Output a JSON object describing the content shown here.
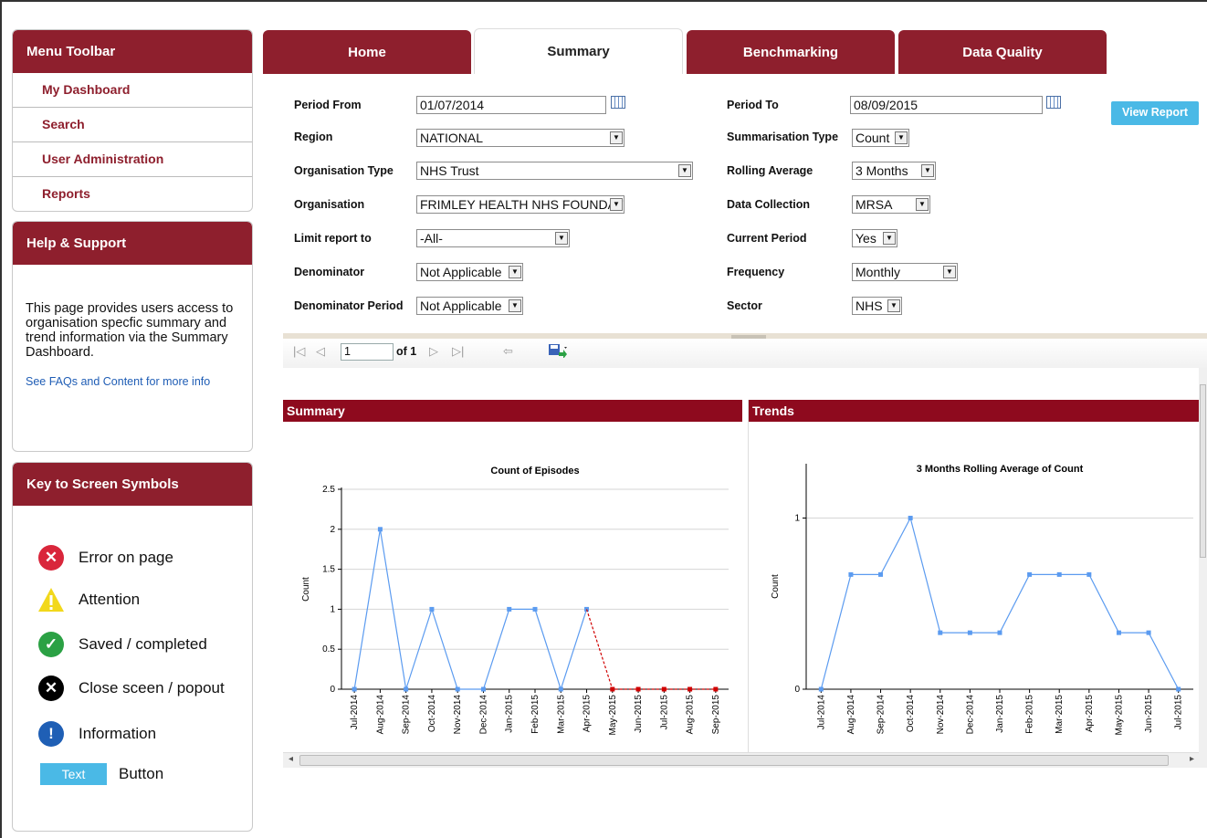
{
  "menu": {
    "title": "Menu Toolbar",
    "items": [
      "My Dashboard",
      "Search",
      "User Administration",
      "Reports"
    ]
  },
  "help": {
    "title": "Help & Support",
    "text": "This page provides users access to organisation specfic summary and trend information via the Summary Dashboard.",
    "link": "See FAQs and Content for more info"
  },
  "key": {
    "title": "Key to Screen Symbols",
    "items": [
      {
        "label": "Error on page",
        "icon": "error-icon",
        "color": "#d9263b",
        "glyph": "✕"
      },
      {
        "label": "Attention",
        "icon": "warning-icon",
        "color": "#f2d81b",
        "glyph": "!"
      },
      {
        "label": "Saved / completed",
        "icon": "check-icon",
        "color": "#2ba144",
        "glyph": "✓"
      },
      {
        "label": "Close sceen / popout",
        "icon": "close-icon",
        "color": "#000000",
        "glyph": "✕"
      },
      {
        "label": "Information",
        "icon": "info-icon",
        "color": "#1f5fb5",
        "glyph": "!"
      }
    ],
    "button_sample": "Text",
    "button_label": "Button"
  },
  "tabs": [
    "Home",
    "Summary",
    "Benchmarking",
    "Data Quality"
  ],
  "form": {
    "left": [
      {
        "label": "Period From",
        "value": "01/07/2014",
        "kind": "date"
      },
      {
        "label": "Region",
        "value": "NATIONAL",
        "kind": "select"
      },
      {
        "label": "Organisation Type",
        "value": "NHS Trust",
        "kind": "select"
      },
      {
        "label": "Organisation",
        "value": "FRIMLEY HEALTH NHS FOUNDATION TRUST",
        "kind": "select"
      },
      {
        "label": "Limit report to",
        "value": "-All-",
        "kind": "select"
      },
      {
        "label": "Denominator",
        "value": "Not Applicable",
        "kind": "select"
      },
      {
        "label": "Denominator Period",
        "value": "Not Applicable",
        "kind": "select"
      }
    ],
    "right": [
      {
        "label": "Period To",
        "value": "08/09/2015",
        "kind": "date"
      },
      {
        "label": "Summarisation Type",
        "value": "Count",
        "kind": "select"
      },
      {
        "label": "Rolling Average",
        "value": "3 Months",
        "kind": "select"
      },
      {
        "label": "Data Collection",
        "value": "MRSA",
        "kind": "select"
      },
      {
        "label": "Current Period",
        "value": "Yes",
        "kind": "select"
      },
      {
        "label": "Frequency",
        "value": "Monthly",
        "kind": "select"
      },
      {
        "label": "Sector",
        "value": "NHS",
        "kind": "select"
      }
    ],
    "view_report": "View Report"
  },
  "report_toolbar": {
    "page": "1",
    "of_pages": "of 1"
  },
  "panels": {
    "summary": "Summary",
    "trends": "Trends"
  },
  "chart_data": [
    {
      "type": "line",
      "title": "Count of Episodes",
      "ylabel": "Count",
      "ylim": [
        0,
        2.5
      ],
      "yticks": [
        0,
        0.5,
        1,
        1.5,
        2,
        2.5
      ],
      "categories": [
        "Jul-2014",
        "Aug-2014",
        "Sep-2014",
        "Oct-2014",
        "Nov-2014",
        "Dec-2014",
        "Jan-2015",
        "Feb-2015",
        "Mar-2015",
        "Apr-2015",
        "May-2015",
        "Jun-2015",
        "Jul-2015",
        "Aug-2015",
        "Sep-2015"
      ],
      "series": [
        {
          "values": [
            0,
            2,
            0,
            1,
            0,
            0,
            1,
            1,
            0,
            1,
            null,
            null,
            null,
            null,
            null
          ],
          "color": "#5b9bf0",
          "style": "solid"
        },
        {
          "values": [
            null,
            null,
            null,
            null,
            null,
            null,
            null,
            null,
            null,
            1,
            0,
            0,
            0,
            0,
            0
          ],
          "color": "#d00000",
          "style": "dashed"
        }
      ],
      "grid": true
    },
    {
      "type": "line",
      "title": "3 Months Rolling Average of Count",
      "ylabel": "Count",
      "ylim": [
        0,
        1.2
      ],
      "yticks": [
        0,
        1
      ],
      "categories": [
        "Jul-2014",
        "Aug-2014",
        "Sep-2014",
        "Oct-2014",
        "Nov-2014",
        "Dec-2014",
        "Jan-2015",
        "Feb-2015",
        "Mar-2015",
        "Apr-2015",
        "May-2015",
        "Jun-2015",
        "Jul-2015"
      ],
      "series": [
        {
          "values": [
            0,
            0.67,
            0.67,
            1,
            0.33,
            0.33,
            0.33,
            0.67,
            0.67,
            0.67,
            0.33,
            0.33,
            0
          ],
          "color": "#5b9bf0",
          "style": "solid"
        }
      ],
      "grid": true
    }
  ]
}
